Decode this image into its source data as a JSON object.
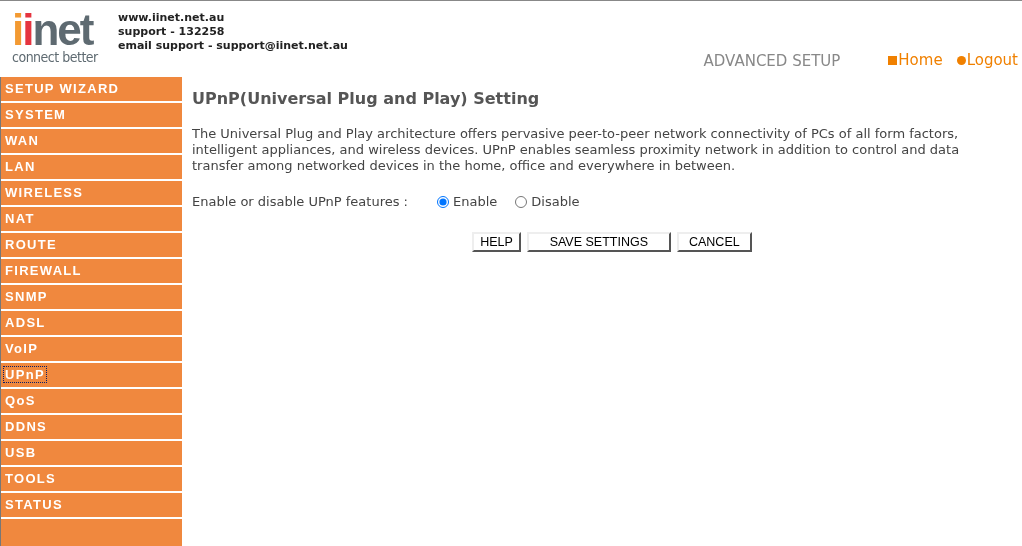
{
  "header": {
    "logo": {
      "parts": [
        {
          "text": "i",
          "color": "#f39a32"
        },
        {
          "text": "i",
          "color": "#e5343f"
        },
        {
          "text": "net",
          "color": "#5e6a71"
        }
      ],
      "tagline": "connect better"
    },
    "contact": [
      "www.iinet.net.au",
      "support - 132258",
      "email support - support@iinet.net.au"
    ],
    "section": "ADVANCED SETUP",
    "links": [
      {
        "label": "Home",
        "kind": "square"
      },
      {
        "label": "Logout",
        "kind": "circle"
      }
    ]
  },
  "sidebar": {
    "items": [
      {
        "label": "SETUP WIZARD",
        "selected": false
      },
      {
        "label": "SYSTEM",
        "selected": false
      },
      {
        "label": "WAN",
        "selected": false
      },
      {
        "label": "LAN",
        "selected": false
      },
      {
        "label": "WIRELESS",
        "selected": false
      },
      {
        "label": "NAT",
        "selected": false
      },
      {
        "label": "ROUTE",
        "selected": false
      },
      {
        "label": "FIREWALL",
        "selected": false
      },
      {
        "label": "SNMP",
        "selected": false
      },
      {
        "label": "ADSL",
        "selected": false
      },
      {
        "label": "VoIP",
        "selected": false
      },
      {
        "label": "UPnP",
        "selected": true
      },
      {
        "label": "QoS",
        "selected": false
      },
      {
        "label": "DDNS",
        "selected": false
      },
      {
        "label": "USB",
        "selected": false
      },
      {
        "label": "TOOLS",
        "selected": false
      },
      {
        "label": "STATUS",
        "selected": false
      }
    ]
  },
  "content": {
    "title": "UPnP(Universal Plug and Play) Setting",
    "description": "The Universal Plug and Play architecture offers pervasive peer-to-peer network connectivity of PCs of all form factors, intelligent appliances, and wireless devices. UPnP enables seamless proximity network in addition to control and data transfer among networked devices in the home, office and everywhere in between.",
    "setting": {
      "label": "Enable or disable UPnP features :",
      "options": [
        {
          "label": "Enable",
          "selected": true
        },
        {
          "label": "Disable",
          "selected": false
        }
      ]
    },
    "buttons": [
      "HELP",
      "SAVE SETTINGS",
      "CANCEL"
    ]
  }
}
